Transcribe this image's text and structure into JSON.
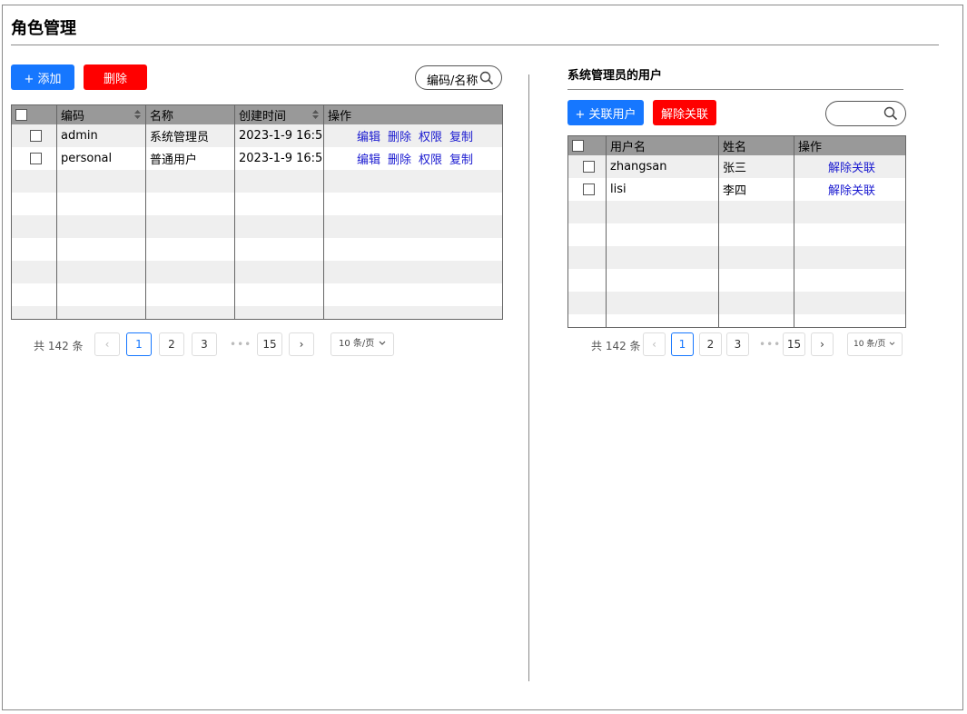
{
  "page_title": "角色管理",
  "left": {
    "add_label": "+ 添加",
    "delete_label": "删除",
    "search_placeholder": "编码/名称",
    "columns": [
      "编码",
      "名称",
      "创建时间",
      "操作"
    ],
    "rows": [
      {
        "code": "admin",
        "name": "系统管理员",
        "created": "2023-1-9 16:5"
      },
      {
        "code": "personal",
        "name": "普通用户",
        "created": "2023-1-9 16:5"
      }
    ],
    "row_actions": [
      "编辑",
      "删除",
      "权限",
      "复制"
    ],
    "pager": {
      "total": "共 142 条",
      "prev": "‹",
      "pages": [
        "1",
        "2",
        "3",
        "15"
      ],
      "dots": "•••",
      "next": "›",
      "size": "10 条/页"
    }
  },
  "right": {
    "title": "系统管理员的用户",
    "link_user_label": "+ 关联用户",
    "unlink_label": "解除关联",
    "columns": [
      "用户名",
      "姓名",
      "操作"
    ],
    "rows": [
      {
        "username": "zhangsan",
        "name": "张三",
        "action": "解除关联"
      },
      {
        "username": "lisi",
        "name": "李四",
        "action": "解除关联"
      }
    ],
    "pager": {
      "total": "共 142 条",
      "prev": "‹",
      "pages": [
        "1",
        "2",
        "3",
        "15"
      ],
      "dots": "•••",
      "next": "›",
      "size": "10 条/页"
    }
  }
}
